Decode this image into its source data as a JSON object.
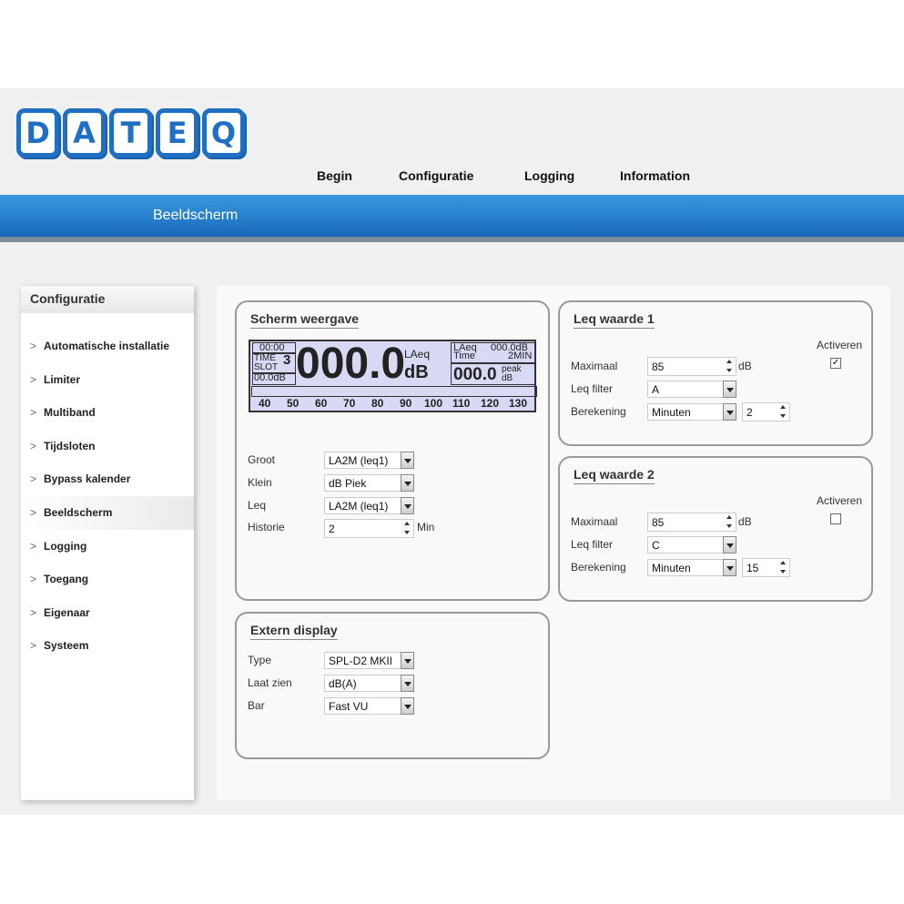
{
  "logo": {
    "letters": [
      "D",
      "A",
      "T",
      "E",
      "Q"
    ],
    "brand_color": "#1f6fc5"
  },
  "topnav": {
    "items": [
      "Begin",
      "Configuratie",
      "Logging",
      "Information"
    ]
  },
  "bluebar": {
    "title": "Beeldscherm"
  },
  "sidebar": {
    "header": "Configuratie",
    "items": [
      "Automatische installatie",
      "Limiter",
      "Multiband",
      "Tijdsloten",
      "Bypass kalender",
      "Beeldscherm",
      "Logging",
      "Toegang",
      "Eigenaar",
      "Systeem"
    ],
    "active": "Beeldscherm"
  },
  "scherm": {
    "title": "Scherm weergave",
    "lcd": {
      "time": "00:00",
      "time_label": "TIME",
      "slot_label": "SLOT",
      "slot": "3",
      "small_db": "00.0dB",
      "big": "000.0",
      "big_top": "LAeq",
      "big_unit": "dB",
      "r_laeq": "LAeq",
      "r_value": "000.0dB",
      "r_time": "Time",
      "r_min": "2MIN",
      "r_big": "000.0",
      "r_peak": "peak",
      "r_db": "dB",
      "scale": [
        "40",
        "50",
        "60",
        "70",
        "80",
        "90",
        "100",
        "110",
        "120",
        "130"
      ]
    },
    "fields": {
      "groot_label": "Groot",
      "groot": "LA2M (leq1)",
      "klein_label": "Klein",
      "klein": "dB Piek",
      "leq_label": "Leq",
      "leq": "LA2M (leq1)",
      "historie_label": "Historie",
      "historie": "2",
      "historie_unit": "Min"
    }
  },
  "extern": {
    "title": "Extern display",
    "type_label": "Type",
    "type": "SPL-D2 MKII",
    "laat_label": "Laat zien",
    "laat": "dB(A)",
    "bar_label": "Bar",
    "bar": "Fast VU"
  },
  "leq1": {
    "title": "Leq waarde 1",
    "activeren_label": "Activeren",
    "activeren": true,
    "check_mark": "✓",
    "max_label": "Maximaal",
    "max": "85",
    "max_unit": "dB",
    "filter_label": "Leq filter",
    "filter": "A",
    "calc_label": "Berekening",
    "calc": "Minuten",
    "calc_value": "2"
  },
  "leq2": {
    "title": "Leq waarde 2",
    "activeren_label": "Activeren",
    "activeren": false,
    "check_mark": "",
    "max_label": "Maximaal",
    "max": "85",
    "max_unit": "dB",
    "filter_label": "Leq filter",
    "filter": "C",
    "calc_label": "Berekening",
    "calc": "Minuten",
    "calc_value": "15"
  }
}
